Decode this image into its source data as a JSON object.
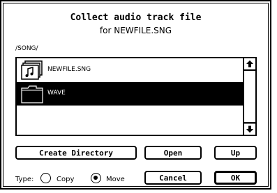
{
  "dialog": {
    "title": "Collect audio track file",
    "subtitle": "for NEWFILE.SNG",
    "path": "/SONG/"
  },
  "files": [
    {
      "name": "NEWFILE.SNG",
      "icon": "song-file-icon",
      "selected": false
    },
    {
      "name": "WAVE",
      "icon": "folder-icon",
      "selected": true
    }
  ],
  "buttons": {
    "create_directory": "Create Directory",
    "open": "Open",
    "up": "Up",
    "cancel": "Cancel",
    "ok": "OK"
  },
  "type": {
    "label": "Type:",
    "options": [
      {
        "label": "Copy",
        "checked": false
      },
      {
        "label": "Move",
        "checked": true
      }
    ]
  }
}
